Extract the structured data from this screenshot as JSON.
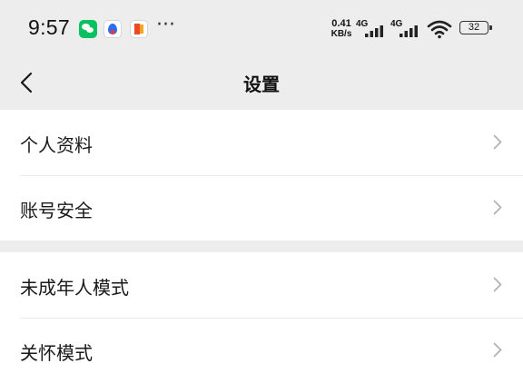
{
  "status_bar": {
    "time": "9:57",
    "more_indicator": "···",
    "net_speed_value": "0.41",
    "net_speed_unit": "KB/s",
    "signal_1_type": "4G",
    "signal_2_type": "4G",
    "battery_level": "32",
    "notification_icons": [
      "wechat-icon",
      "baidu-netdisk-icon",
      "office-icon"
    ]
  },
  "header": {
    "back_icon": "chevron-left-icon",
    "title": "设置"
  },
  "groups": [
    {
      "items": [
        {
          "label": "个人资料",
          "icon": "chevron-right-icon"
        },
        {
          "label": "账号安全",
          "icon": "chevron-right-icon"
        }
      ]
    },
    {
      "items": [
        {
          "label": "未成年人模式",
          "icon": "chevron-right-icon"
        },
        {
          "label": "关怀模式",
          "icon": "chevron-right-icon"
        }
      ]
    }
  ],
  "colors": {
    "page_background": "#ededed",
    "row_background": "#ffffff",
    "text": "#191919",
    "chevron": "#b2b2b2"
  }
}
